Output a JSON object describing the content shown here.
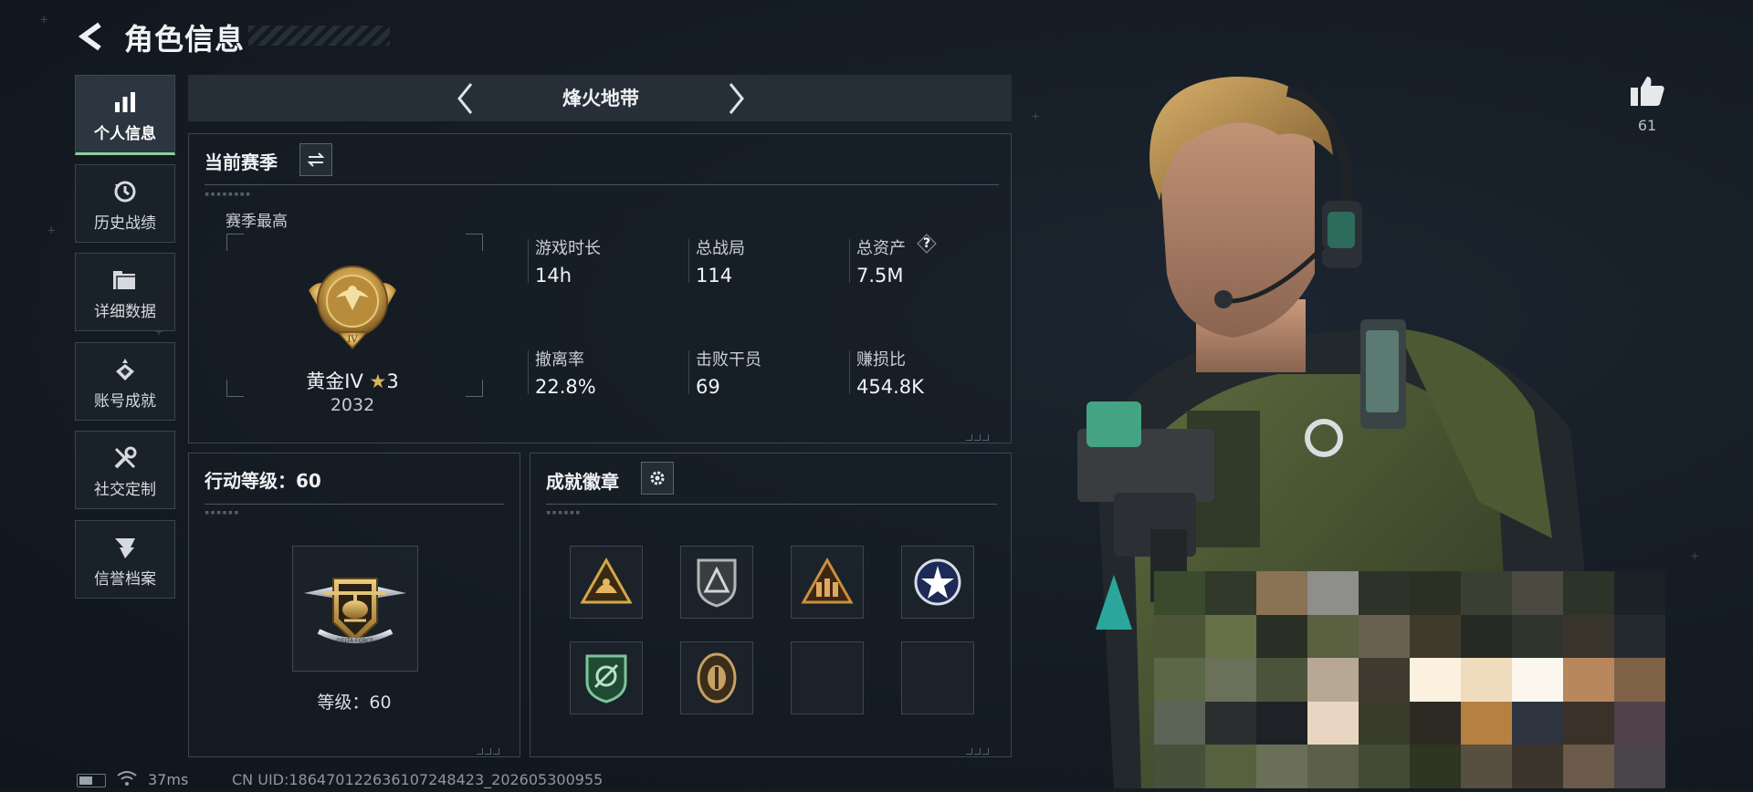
{
  "header": {
    "title": "角色信息"
  },
  "sidebar": {
    "items": [
      {
        "label": "个人信息",
        "active": true,
        "icon": "bar-chart-icon"
      },
      {
        "label": "历史战绩",
        "active": false,
        "icon": "history-clock-icon"
      },
      {
        "label": "详细数据",
        "active": false,
        "icon": "folder-icon"
      },
      {
        "label": "账号成就",
        "active": false,
        "icon": "achievement-icon"
      },
      {
        "label": "社交定制",
        "active": false,
        "icon": "tools-icon"
      },
      {
        "label": "信誉档案",
        "active": false,
        "icon": "reputation-icon"
      }
    ]
  },
  "mode": {
    "name": "烽火地带"
  },
  "season": {
    "title": "当前赛季",
    "best_label": "赛季最高",
    "rank_name": "黄金IV",
    "rank_stars": "3",
    "rank_score": "2032",
    "stats": [
      {
        "label": "游戏时长",
        "value": "14h"
      },
      {
        "label": "总战局",
        "value": "114"
      },
      {
        "label": "总资产",
        "value": "7.5M",
        "help": "?"
      },
      {
        "label": "撤离率",
        "value": "22.8%"
      },
      {
        "label": "击败干员",
        "value": "69"
      },
      {
        "label": "赚损比",
        "value": "454.8K"
      }
    ]
  },
  "action_level": {
    "title": "行动等级：60",
    "level_text": "等级：60",
    "emblem_text": "DELTA FORCE"
  },
  "achievements": {
    "title": "成就徽章",
    "badges": [
      "triangle-gold-badge",
      "shield-silver-badge",
      "triangle-team-badge",
      "star-circle-badge",
      "green-shield-badge",
      "oval-bronze-badge",
      "empty-slot",
      "empty-slot"
    ]
  },
  "like": {
    "count": "61"
  },
  "footer": {
    "ping": "37ms",
    "uid": "CN UID:1864701226361072484​23_202605300955"
  },
  "colors": {
    "accent_green": "#86d29a",
    "gold": "#c9a24a",
    "panel_border": "#3b4650"
  }
}
